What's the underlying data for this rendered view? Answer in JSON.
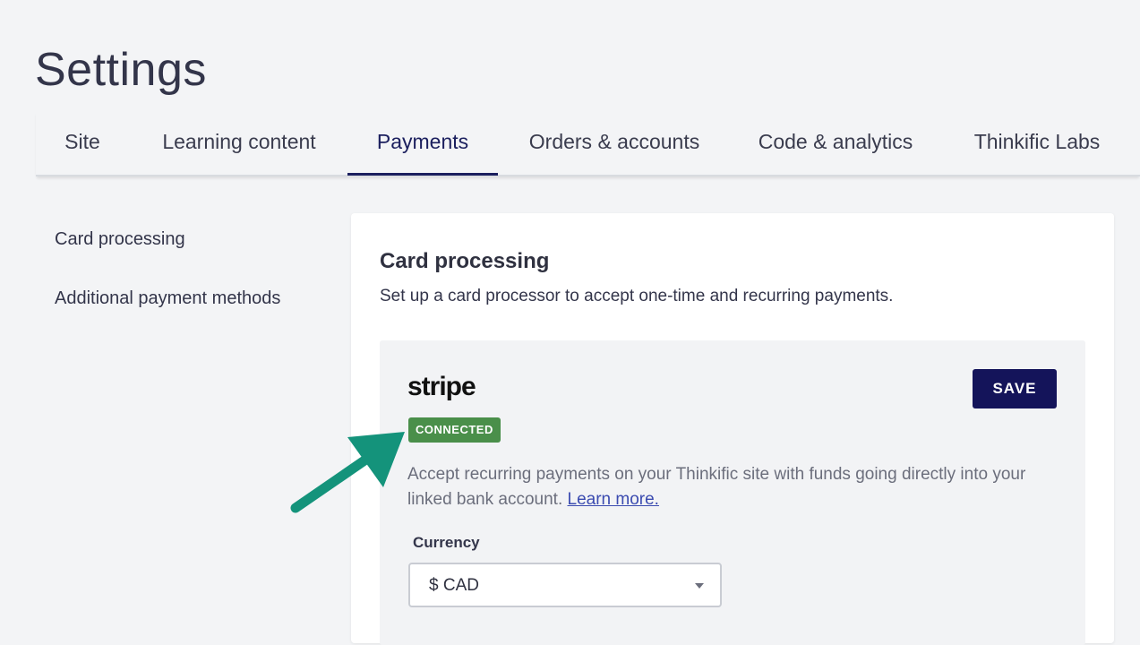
{
  "page": {
    "title": "Settings"
  },
  "tabs": [
    {
      "label": "Site",
      "active": false
    },
    {
      "label": "Learning content",
      "active": false
    },
    {
      "label": "Payments",
      "active": true
    },
    {
      "label": "Orders & accounts",
      "active": false
    },
    {
      "label": "Code & analytics",
      "active": false
    },
    {
      "label": "Thinkific Labs",
      "active": false
    }
  ],
  "side_nav": {
    "items": [
      {
        "label": "Card processing"
      },
      {
        "label": "Additional payment methods"
      }
    ]
  },
  "card": {
    "title": "Card processing",
    "subtitle": "Set up a card processor to accept one-time and recurring payments."
  },
  "provider": {
    "logo_text": "stripe",
    "save_label": "SAVE",
    "status_badge": "CONNECTED",
    "description": "Accept recurring payments on your Thinkific site with funds going directly into your linked bank account.",
    "learn_more_label": "Learn more.",
    "currency_label": "Currency",
    "currency_value": "$ CAD"
  },
  "colors": {
    "accent_navy": "#14145a",
    "connected_green": "#4a8f4a",
    "annotation_arrow": "#14937b",
    "link_blue": "#3b4bb0"
  }
}
